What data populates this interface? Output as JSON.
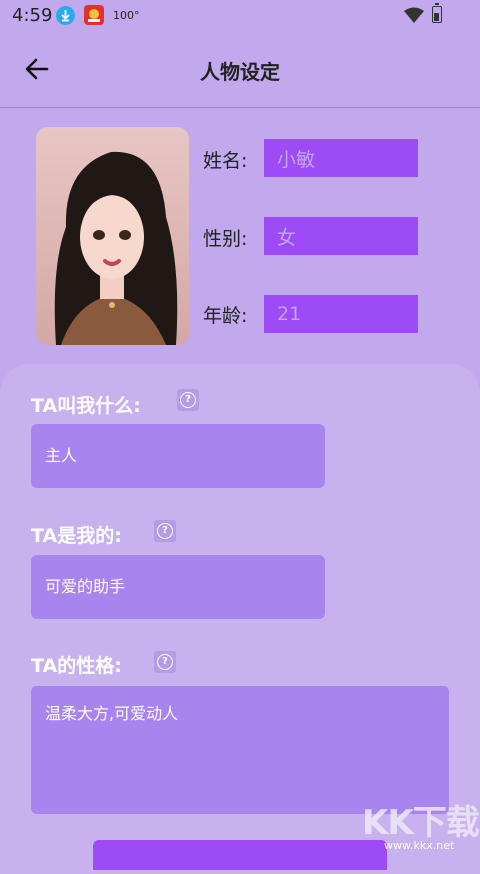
{
  "status_bar": {
    "time": "4:59",
    "temperature": "100°"
  },
  "header": {
    "title": "人物设定"
  },
  "profile": {
    "name_label": "姓名:",
    "name_value": "小敏",
    "gender_label": "性别:",
    "gender_value": "女",
    "age_label": "年龄:",
    "age_value": "21"
  },
  "sections": {
    "call_me": {
      "label": "TA叫我什么:",
      "value": "主人"
    },
    "relation": {
      "label": "TA是我的:",
      "value": "可爱的助手"
    },
    "personality": {
      "label": "TA的性格:",
      "value": "温柔大方,可爱动人"
    }
  },
  "watermark": {
    "logo_text": "KK下载",
    "url": "www.kkx.net"
  },
  "colors": {
    "background": "#c2a9ee",
    "accent": "#9d4bf7",
    "field": "#a885ee"
  }
}
